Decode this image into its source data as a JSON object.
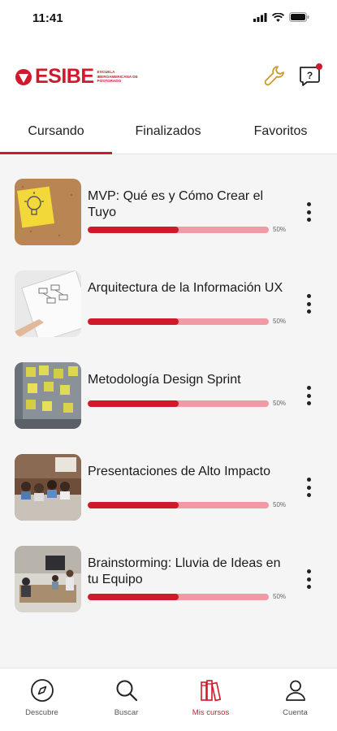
{
  "status": {
    "time": "11:41"
  },
  "header": {
    "logo_text": "ESIBE",
    "logo_subtitle": "ESCUELA IBEROAMERICANA DE POSTGRADO",
    "tools_icon": "wrench-icon",
    "help_icon": "help-chat-icon"
  },
  "tabs": [
    {
      "label": "Cursando",
      "active": true
    },
    {
      "label": "Finalizados",
      "active": false
    },
    {
      "label": "Favoritos",
      "active": false
    }
  ],
  "courses": [
    {
      "title": "MVP: Qué es y Cómo Crear el Tuyo",
      "progress": 0.5,
      "progress_label": "50%"
    },
    {
      "title": "Arquitectura de la Información UX",
      "progress": 0.5,
      "progress_label": "50%"
    },
    {
      "title": "Metodología Design Sprint",
      "progress": 0.5,
      "progress_label": "50%"
    },
    {
      "title": "Presentaciones de Alto Impacto",
      "progress": 0.5,
      "progress_label": "50%"
    },
    {
      "title": "Brainstorming: Lluvia de Ideas en tu Equipo",
      "progress": 0.5,
      "progress_label": "50%"
    }
  ],
  "bottom_nav": [
    {
      "label": "Descubre",
      "icon": "compass-icon",
      "active": false
    },
    {
      "label": "Buscar",
      "icon": "search-icon",
      "active": false
    },
    {
      "label": "Mis cursos",
      "icon": "books-icon",
      "active": true
    },
    {
      "label": "Cuenta",
      "icon": "user-icon",
      "active": false
    }
  ],
  "colors": {
    "brand": "#d0192a",
    "progress_track": "#ef9aa4"
  }
}
